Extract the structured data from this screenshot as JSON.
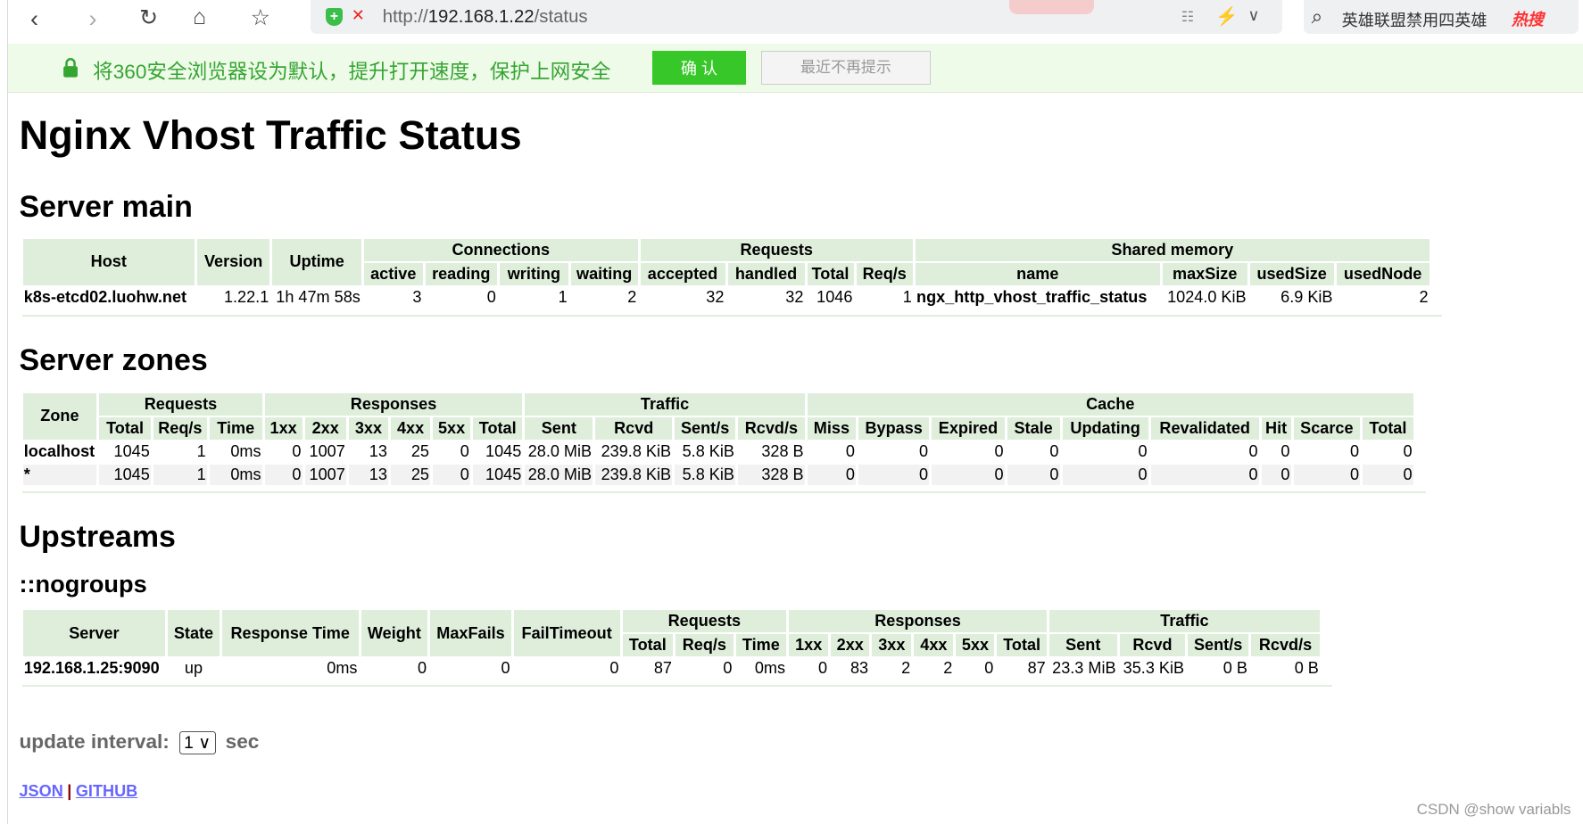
{
  "browser": {
    "url_prefix": "http://",
    "url_host": "192.168.1.22",
    "url_path": "/status",
    "search_text": "英雄联盟禁用四英雄",
    "hot_label": "热搜",
    "banner_message": "将360安全浏览器设为默认，提升打开速度，保护上网安全",
    "confirm_label": "确 认",
    "dismiss_label": "最近不再提示"
  },
  "page": {
    "title": "Nginx Vhost Traffic Status",
    "server_main": {
      "heading": "Server main",
      "group_headers": [
        "Connections",
        "Requests",
        "Shared memory"
      ],
      "headers": [
        "Host",
        "Version",
        "Uptime",
        "active",
        "reading",
        "writing",
        "waiting",
        "accepted",
        "handled",
        "Total",
        "Req/s",
        "name",
        "maxSize",
        "usedSize",
        "usedNode"
      ],
      "rows": [
        [
          "k8s-etcd02.luohw.net",
          "1.22.1",
          "1h 47m 58s",
          "3",
          "0",
          "1",
          "2",
          "32",
          "32",
          "1046",
          "1",
          "ngx_http_vhost_traffic_status",
          "1024.0 KiB",
          "6.9 KiB",
          "2"
        ]
      ]
    },
    "server_zones": {
      "heading": "Server zones",
      "group_headers": [
        "Requests",
        "Responses",
        "Traffic",
        "Cache"
      ],
      "headers": [
        "Zone",
        "Total",
        "Req/s",
        "Time",
        "1xx",
        "2xx",
        "3xx",
        "4xx",
        "5xx",
        "Total",
        "Sent",
        "Rcvd",
        "Sent/s",
        "Rcvd/s",
        "Miss",
        "Bypass",
        "Expired",
        "Stale",
        "Updating",
        "Revalidated",
        "Hit",
        "Scarce",
        "Total"
      ],
      "rows": [
        [
          "localhost",
          "1045",
          "1",
          "0ms",
          "0",
          "1007",
          "13",
          "25",
          "0",
          "1045",
          "28.0 MiB",
          "239.8 KiB",
          "5.8 KiB",
          "328 B",
          "0",
          "0",
          "0",
          "0",
          "0",
          "0",
          "0",
          "0",
          "0"
        ],
        [
          "*",
          "1045",
          "1",
          "0ms",
          "0",
          "1007",
          "13",
          "25",
          "0",
          "1045",
          "28.0 MiB",
          "239.8 KiB",
          "5.8 KiB",
          "328 B",
          "0",
          "0",
          "0",
          "0",
          "0",
          "0",
          "0",
          "0",
          "0"
        ]
      ]
    },
    "upstreams": {
      "heading": "Upstreams",
      "group_name": "::nogroups",
      "group_headers": [
        "Requests",
        "Responses",
        "Traffic"
      ],
      "headers": [
        "Server",
        "State",
        "Response Time",
        "Weight",
        "MaxFails",
        "FailTimeout",
        "Total",
        "Req/s",
        "Time",
        "1xx",
        "2xx",
        "3xx",
        "4xx",
        "5xx",
        "Total",
        "Sent",
        "Rcvd",
        "Sent/s",
        "Rcvd/s"
      ],
      "rows": [
        [
          "192.168.1.25:9090",
          "up",
          "0ms",
          "0",
          "0",
          "0",
          "87",
          "0",
          "0ms",
          "0",
          "83",
          "2",
          "2",
          "0",
          "87",
          "23.3 MiB",
          "35.3 KiB",
          "0 B",
          "0 B"
        ]
      ]
    },
    "update_interval": {
      "label": "update interval:",
      "value": "1",
      "unit": "sec"
    },
    "links": {
      "json": "JSON",
      "separator": "|",
      "github": "GITHUB"
    },
    "watermark": "CSDN @show variabls"
  },
  "colors": {
    "header_bg": "#deeedb",
    "link": "#6666ff",
    "banner_green": "#35a532",
    "confirm_bg": "#38c728"
  }
}
